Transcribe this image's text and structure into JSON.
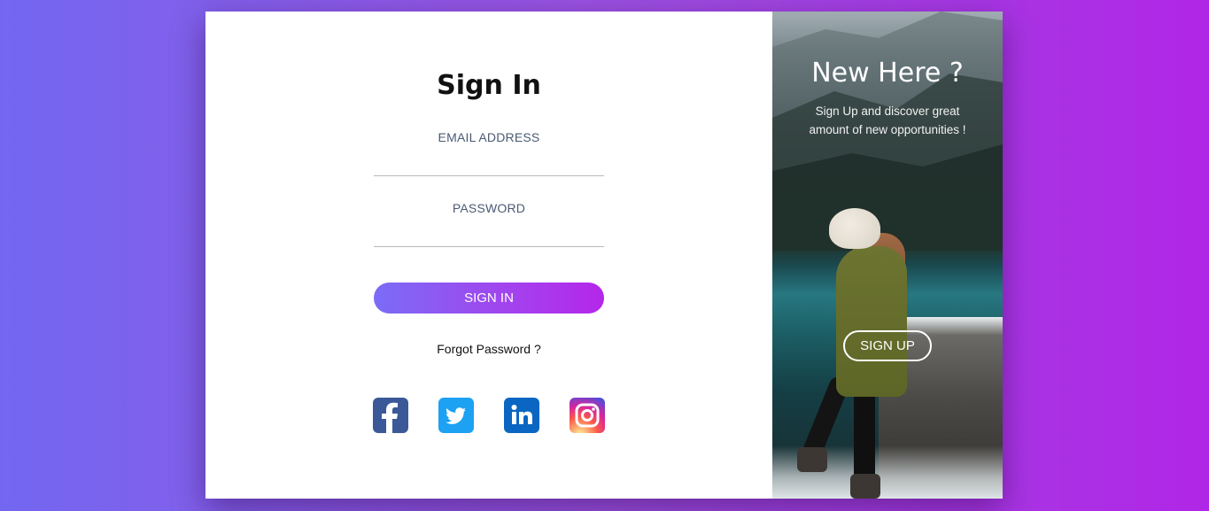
{
  "signin": {
    "title": "Sign In",
    "email_label": "EMAIL ADDRESS",
    "email_value": "",
    "password_label": "PASSWORD",
    "password_value": "",
    "button_label": "SIGN IN",
    "forgot_label": "Forgot Password ?"
  },
  "social": [
    {
      "name": "facebook-icon",
      "color": "#3b5998"
    },
    {
      "name": "twitter-icon",
      "color": "#1da1f2"
    },
    {
      "name": "linkedin-icon",
      "color": "#0a66c2"
    },
    {
      "name": "instagram-icon",
      "color": "#d6249f"
    }
  ],
  "signup_panel": {
    "title": "New Here ?",
    "subtitle": "Sign Up and discover great amount of new opportunities !",
    "button_label": "SIGN UP"
  },
  "colors": {
    "gradient_start": "#7367f0",
    "gradient_end": "#b026e6",
    "button_gradient_start": "#7b6cf6",
    "button_gradient_end": "#b427ea"
  }
}
